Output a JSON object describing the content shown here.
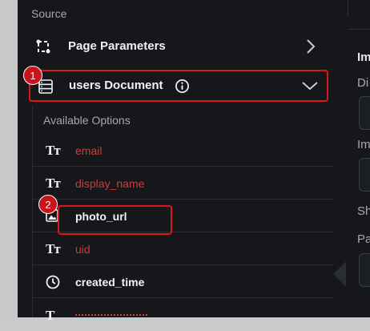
{
  "source": {
    "label": "Source"
  },
  "page_parameters": {
    "label": "Page Parameters"
  },
  "users_document": {
    "label": "users Document"
  },
  "badges": {
    "one": "1",
    "two": "2"
  },
  "available_options": {
    "header": "Available Options",
    "items": [
      {
        "label": "email",
        "icon": "text-type-icon",
        "glyph": "Tт"
      },
      {
        "label": "display_name",
        "icon": "text-type-icon",
        "glyph": "Tт"
      },
      {
        "label": "photo_url",
        "icon": "image-icon"
      },
      {
        "label": "uid",
        "icon": "text-type-icon",
        "glyph": "Tт"
      },
      {
        "label": "created_time",
        "icon": "clock-icon"
      }
    ]
  },
  "right_panel": {
    "letters": [
      "Im",
      "Di",
      "Im",
      "Sh",
      "Pa"
    ]
  },
  "colors": {
    "panel_bg": "#15171a",
    "highlight_red": "#e0151b",
    "field_red_text": "#d23a3a"
  }
}
